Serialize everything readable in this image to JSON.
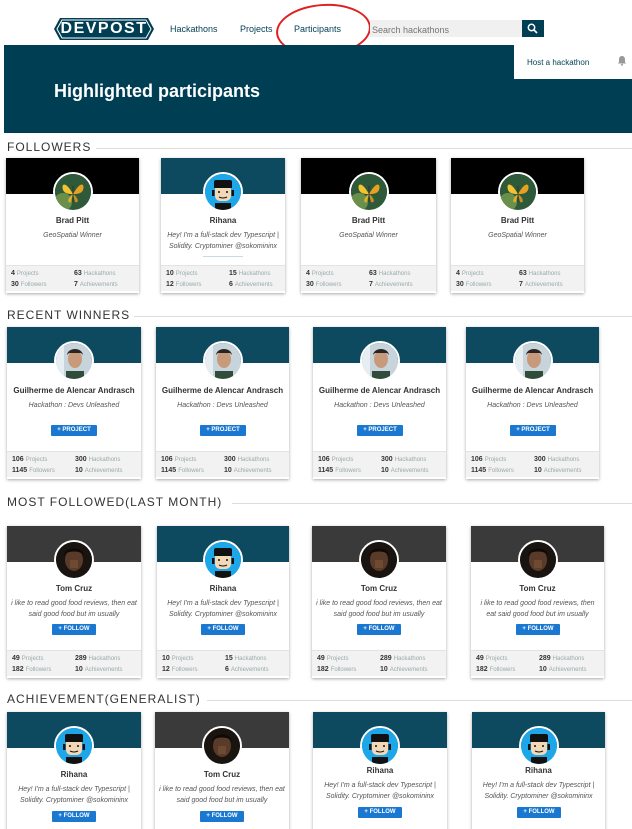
{
  "nav": {
    "logo": "DEVPOST",
    "links": [
      "Hackathons",
      "Projects",
      "Participants"
    ],
    "search_placeholder": "Search hackathons",
    "host_link": "Host a hackathon"
  },
  "hero": {
    "title": "Highlighted participants"
  },
  "colors": {
    "brand": "#003e54",
    "button": "#1b78d1",
    "circle": "#e02020"
  },
  "icons": {
    "search": "search-icon",
    "bell": "bell-icon"
  },
  "sections": [
    {
      "title": "FOLLOWERS",
      "cards": [
        {
          "name": "Brad Pitt",
          "desc": "GeoSpatial Winner",
          "s1": "4",
          "l1": "Projects",
          "s2": "63",
          "l2": "Hackathons",
          "s3": "30",
          "l3": "Followers",
          "s4": "7",
          "l4": "Achievements"
        },
        {
          "name": "Rihana",
          "desc": "Hey! I'm a full-stack dev Typescript | Solidity. Cryptominer @sokomininx",
          "s1": "10",
          "l1": "Projects",
          "s2": "15",
          "l2": "Hackathons",
          "s3": "12",
          "l3": "Followers",
          "s4": "6",
          "l4": "Achievements"
        },
        {
          "name": "Brad Pitt",
          "desc": "GeoSpatial Winner",
          "s1": "4",
          "l1": "Projects",
          "s2": "63",
          "l2": "Hackathons",
          "s3": "30",
          "l3": "Followers",
          "s4": "7",
          "l4": "Achievements"
        },
        {
          "name": "Brad Pitt",
          "desc": "GeoSpatial Winner",
          "s1": "4",
          "l1": "Projects",
          "s2": "63",
          "l2": "Hackathons",
          "s3": "30",
          "l3": "Followers",
          "s4": "7",
          "l4": "Achievements"
        }
      ]
    },
    {
      "title": "RECENT WINNERS",
      "cards": [
        {
          "name": "Guilherme de Alencar Andrasch",
          "desc": "Hackathon : Devs Unleashed",
          "btn": "+ PROJECT",
          "s1": "106",
          "l1": "Projects",
          "s2": "300",
          "l2": "Hackathons",
          "s3": "1145",
          "l3": "Followers",
          "s4": "10",
          "l4": "Achievements"
        },
        {
          "name": "Guilherme de Alencar Andrasch",
          "desc": "Hackathon : Devs Unleashed",
          "btn": "+ PROJECT",
          "s1": "106",
          "l1": "Projects",
          "s2": "300",
          "l2": "Hackathons",
          "s3": "1145",
          "l3": "Followers",
          "s4": "10",
          "l4": "Achievements"
        },
        {
          "name": "Guilherme de Alencar Andrasch",
          "desc": "Hackathon : Devs Unleashed",
          "btn": "+ PROJECT",
          "s1": "106",
          "l1": "Projects",
          "s2": "300",
          "l2": "Hackathons",
          "s3": "1145",
          "l3": "Followers",
          "s4": "10",
          "l4": "Achievements"
        },
        {
          "name": "Guilherme de Alencar Andrasch",
          "desc": "Hackathon : Devs Unleashed",
          "btn": "+ PROJECT",
          "s1": "106",
          "l1": "Projects",
          "s2": "300",
          "l2": "Hackathons",
          "s3": "1145",
          "l3": "Followers",
          "s4": "10",
          "l4": "Achievements"
        }
      ]
    },
    {
      "title": "MOST FOLLOWED(LAST MONTH)",
      "cards": [
        {
          "name": "Tom Cruz",
          "desc": "i like to read good food reviews, then eat said good food but im usually",
          "btn": "+ FOLLOW",
          "s1": "49",
          "l1": "Projects",
          "s2": "289",
          "l2": "Hackathons",
          "s3": "182",
          "l3": "Followers",
          "s4": "10",
          "l4": "Achievements"
        },
        {
          "name": "Rihana",
          "desc": "Hey! I'm a full-stack dev Typescript | Solidity. Cryptominer @sokomininx",
          "btn": "+ FOLLOW",
          "s1": "10",
          "l1": "Projects",
          "s2": "15",
          "l2": "Hackathons",
          "s3": "12",
          "l3": "Followers",
          "s4": "6",
          "l4": "Achievements"
        },
        {
          "name": "Tom Cruz",
          "desc": "i like to read good food reviews, then eat said good food but im usually",
          "btn": "+ FOLLOW",
          "s1": "49",
          "l1": "Projects",
          "s2": "289",
          "l2": "Hackathons",
          "s3": "182",
          "l3": "Followers",
          "s4": "10",
          "l4": "Achievements"
        },
        {
          "name": "Tom Cruz",
          "desc": "i like to read good food reviews, then eat said good food but im usually",
          "btn": "+ FOLLOW",
          "s1": "49",
          "l1": "Projects",
          "s2": "289",
          "l2": "Hackathons",
          "s3": "182",
          "l3": "Followers",
          "s4": "10",
          "l4": "Achievements"
        }
      ]
    },
    {
      "title": "ACHIEVEMENT(GENERALIST)",
      "cards": [
        {
          "name": "Rihana",
          "desc": "Hey! I'm a full-stack dev Typescript | Solidity. Cryptominer @sokomininx",
          "btn": "+ FOLLOW"
        },
        {
          "name": "Tom Cruz",
          "desc": "i like to read good food reviews, then eat said good food but im usually",
          "btn": "+ FOLLOW"
        },
        {
          "name": "Rihana",
          "desc": "Hey! I'm a full-stack dev Typescript | Solidity. Cryptominer @sokomininx",
          "btn": "+ FOLLOW"
        },
        {
          "name": "Rihana",
          "desc": "Hey! I'm a full-stack dev Typescript | Solidity. Cryptominer @sokomininx",
          "btn": "+ FOLLOW"
        }
      ]
    }
  ]
}
